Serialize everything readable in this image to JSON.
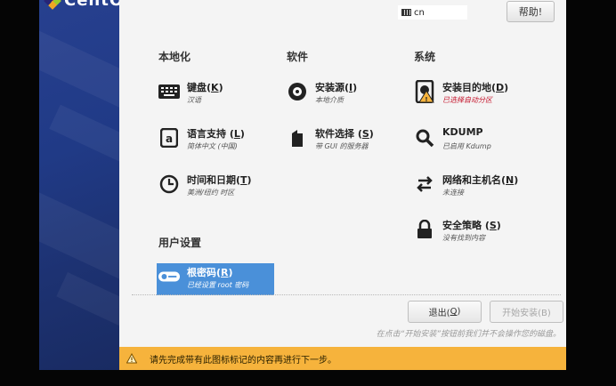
{
  "brand": {
    "name": "CentOS"
  },
  "header": {
    "keyboard_layout": "cn",
    "help_label": "帮助!"
  },
  "categories": {
    "localization": "本地化",
    "software": "软件",
    "system": "系统",
    "user_settings": "用户设置"
  },
  "spokes": {
    "keyboard": {
      "title_pre": "键盘(",
      "key": "K",
      "title_post": ")",
      "status": "汉语"
    },
    "language": {
      "title_pre": "语言支持 (",
      "key": "L",
      "title_post": ")",
      "status": "简体中文 (中国)"
    },
    "datetime": {
      "title_pre": "时间和日期(",
      "key": "T",
      "title_post": ")",
      "status": "美洲/纽约 时区"
    },
    "source": {
      "title_pre": "安装源(",
      "key": "I",
      "title_post": ")",
      "status": "本地介质"
    },
    "software": {
      "title_pre": "软件选择 (",
      "key": "S",
      "title_post": ")",
      "status": "带 GUI 的服务器"
    },
    "dest": {
      "title_pre": "安装目的地(",
      "key": "D",
      "title_post": ")",
      "status": "已选择自动分区"
    },
    "kdump": {
      "title_pre": "KDUMP",
      "key": "",
      "title_post": "",
      "status": "已启用 Kdump"
    },
    "network": {
      "title_pre": "网络和主机名(",
      "key": "N",
      "title_post": ")",
      "status": "未连接"
    },
    "security": {
      "title_pre": "安全策略 (",
      "key": "S",
      "title_post": ")",
      "status": "没有找到内容"
    },
    "root": {
      "title_pre": "根密码(",
      "key": "R",
      "title_post": ")",
      "status": "已经设置 root 密码"
    }
  },
  "buttons": {
    "quit_pre": "退出(",
    "quit_key": "Q",
    "quit_post": ")",
    "begin_label": "开始安装(B)"
  },
  "hint": "在点击“开始安装”按钮前我们并不会操作您的磁盘。",
  "warning": "请先完成带有此图标标记的内容再进行下一步。",
  "colors": {
    "sidebar": "#203a86",
    "warning_bar": "#f6b33c",
    "selected": "#4a90d9",
    "error": "#c4132a"
  }
}
